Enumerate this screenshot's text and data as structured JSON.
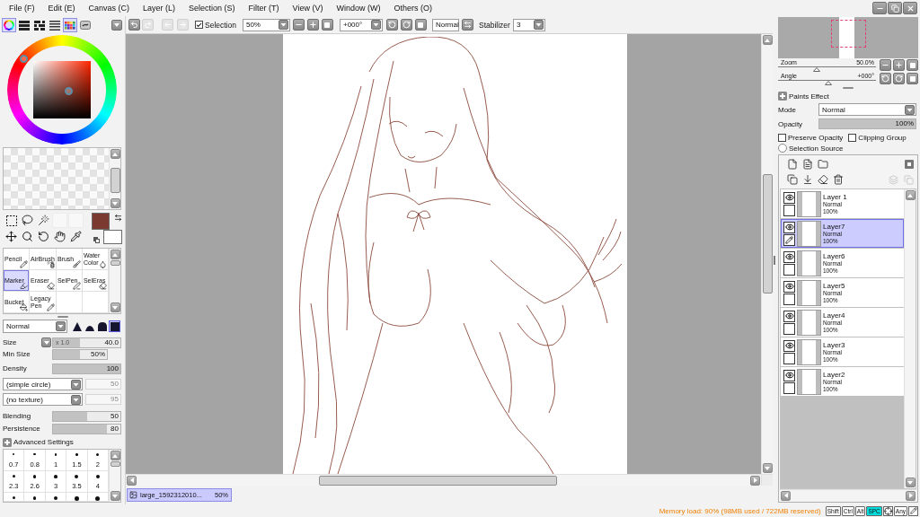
{
  "menu": [
    "File (F)",
    "Edit (E)",
    "Canvas (C)",
    "Layer (L)",
    "Selection (S)",
    "Filter (T)",
    "View (V)",
    "Window (W)",
    "Others (O)"
  ],
  "color_panel": {
    "modes": [
      {
        "kind": "wheel",
        "on": true
      },
      {
        "kind": "rgb",
        "on": false
      },
      {
        "kind": "hsv",
        "on": false
      },
      {
        "kind": "list",
        "on": false
      },
      {
        "kind": "swatches",
        "on": true
      },
      {
        "kind": "scratchpad",
        "on": false
      }
    ]
  },
  "tools": [
    {
      "label": "Pencil",
      "kind": "pencil",
      "selected": false
    },
    {
      "label": "AirBrush",
      "kind": "airbrush",
      "selected": false
    },
    {
      "label": "Brush",
      "kind": "brush",
      "selected": false
    },
    {
      "label": "Water Color",
      "kind": "watercolor",
      "selected": false
    },
    {
      "label": "Marker",
      "kind": "marker",
      "selected": true
    },
    {
      "label": "Eraser",
      "kind": "eraser",
      "selected": false
    },
    {
      "label": "SelPen",
      "kind": "selpen",
      "selected": false
    },
    {
      "label": "SelEras",
      "kind": "seleras",
      "selected": false
    },
    {
      "label": "Bucket",
      "kind": "bucket",
      "selected": false
    },
    {
      "label": "Legacy Pen",
      "kind": "legacypen",
      "selected": false
    }
  ],
  "brush": {
    "mode": "Normal",
    "shapes": [
      {
        "kind": "peak",
        "selected": false
      },
      {
        "kind": "mound",
        "selected": false
      },
      {
        "kind": "dome",
        "selected": false
      },
      {
        "kind": "flat",
        "selected": true
      }
    ],
    "size": {
      "label": "Size",
      "multiplier": "x 1.0",
      "value": "40.0",
      "level": 0.4
    },
    "min_size": {
      "label": "Min Size",
      "value": "50%",
      "level": 0.5
    },
    "density": {
      "label": "Density",
      "value": "100",
      "level": 1
    },
    "shape": {
      "value": "(simple circle)",
      "amount": "50",
      "disabled": true
    },
    "texture": {
      "value": "(no texture)",
      "amount": "95",
      "disabled": true
    },
    "blending": {
      "label": "Blending",
      "value": "50",
      "level": 0.5
    },
    "persistence": {
      "label": "Persistence",
      "value": "80",
      "level": 0.8
    },
    "advanced_settings": "Advanced Settings",
    "sizes": [
      "0.7",
      "0.8",
      "1",
      "1.5",
      "2",
      "2.3",
      "2.6",
      "3",
      "3.5",
      "4"
    ]
  },
  "toolbar": {
    "history": [
      {
        "kind": "undo",
        "disabled": false
      },
      {
        "kind": "redo",
        "disabled": true
      },
      {
        "kind": "back",
        "disabled": true
      },
      {
        "kind": "forward",
        "disabled": true
      }
    ],
    "selection": {
      "label": "Selection",
      "checked": true
    },
    "zoom": "50%",
    "angle": "+000°",
    "blend_mode": "Normal",
    "stabilizer": {
      "label": "Stabilizer",
      "value": "3"
    }
  },
  "canvas_tab": {
    "title": "large_1592312010...",
    "zoom": "50%",
    "selected": true
  },
  "navigator": {
    "zoom": {
      "label": "Zoom",
      "value": "50.0%",
      "level": 0.39
    },
    "angle": {
      "label": "Angle",
      "value": "+000°",
      "level": 0.51
    }
  },
  "layer_properties": {
    "paints_effect": "Paints Effect",
    "mode": {
      "label": "Mode",
      "value": "Normal"
    },
    "opacity": {
      "label": "Opacity",
      "value": "100%",
      "level": 1
    },
    "preserve_opacity": {
      "label": "Preserve Opacity",
      "checked": false
    },
    "clipping_group": {
      "label": "Clipping Group",
      "checked": false
    },
    "selection_source": {
      "label": "Selection Source",
      "checked": false
    }
  },
  "layers": [
    {
      "name": "Layer 1",
      "mode": "Normal",
      "opacity": "100%",
      "visible": true,
      "selected": false
    },
    {
      "name": "Layer7",
      "mode": "Normal",
      "opacity": "100%",
      "visible": true,
      "selected": true
    },
    {
      "name": "Layer6",
      "mode": "Normal",
      "opacity": "100%",
      "visible": true,
      "selected": false
    },
    {
      "name": "Layer5",
      "mode": "Normal",
      "opacity": "100%",
      "visible": true,
      "selected": false
    },
    {
      "name": "Layer4",
      "mode": "Normal",
      "opacity": "100%",
      "visible": true,
      "selected": false
    },
    {
      "name": "Layer3",
      "mode": "Normal",
      "opacity": "100%",
      "visible": true,
      "selected": false
    },
    {
      "name": "Layer2",
      "mode": "Normal",
      "opacity": "100%",
      "visible": true,
      "selected": false
    }
  ],
  "status_bar": {
    "memory": "Memory load: 90% (98MB used / 722MB reserved)",
    "keys": [
      {
        "label": "Shift",
        "on": false
      },
      {
        "label": "Ctrl",
        "on": false
      },
      {
        "label": "Alt",
        "on": false
      },
      {
        "label": "SPC",
        "on": true
      }
    ],
    "any": {
      "label": "Any",
      "on": false
    }
  }
}
